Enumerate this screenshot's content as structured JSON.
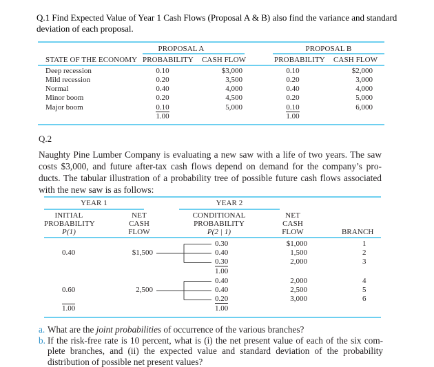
{
  "q1": {
    "title": "Q.1 Find Expected Value of Year 1 Cash Flows (Proposal A & B) also find the variance and standard deviation of each proposal.",
    "table": {
      "group_headers": [
        "PROPOSAL A",
        "PROPOSAL B"
      ],
      "col_headers": [
        "STATE OF THE ECONOMY",
        "PROBABILITY",
        "CASH FLOW",
        "PROBABILITY",
        "CASH FLOW"
      ],
      "rows": [
        {
          "state": "Deep recession",
          "prob_a": "0.10",
          "cf_a": "$3,000",
          "prob_b": "0.10",
          "cf_b": "$2,000"
        },
        {
          "state": "Mild recession",
          "prob_a": "0.20",
          "cf_a": "3,500",
          "prob_b": "0.20",
          "cf_b": "3,000"
        },
        {
          "state": "Normal",
          "prob_a": "0.40",
          "cf_a": "4,000",
          "prob_b": "0.40",
          "cf_b": "4,000"
        },
        {
          "state": "Minor boom",
          "prob_a": "0.20",
          "cf_a": "4,500",
          "prob_b": "0.20",
          "cf_b": "5,000"
        },
        {
          "state": "Major boom",
          "prob_a": "0.10",
          "cf_a": "5,000",
          "prob_b": "0.10",
          "cf_b": "6,000"
        }
      ],
      "totals": {
        "prob_a": "1.00",
        "prob_b": "1.00"
      }
    }
  },
  "q2": {
    "label": "Q.2",
    "paragraph": "Naughty Pine Lumber Company is evaluating a new saw with a life of two years. The saw costs $3,000, and future after-tax cash flows depend on demand for the company’s pro-ducts. The tabular illustration of a probability tree of possible future cash flows associated with the new saw is as follows:",
    "table": {
      "group_headers": [
        "YEAR 1",
        "YEAR 2"
      ],
      "col_headers": {
        "initial_prob": [
          "INITIAL",
          "PROBABILITY",
          "P(1)"
        ],
        "net_cf1": [
          "NET",
          "CASH",
          "FLOW"
        ],
        "cond_prob": [
          "CONDITIONAL",
          "PROBABILITY",
          "P(2 | 1)"
        ],
        "net_cf2": [
          "NET",
          "CASH",
          "FLOW"
        ],
        "branch": "BRANCH"
      },
      "groups": [
        {
          "initial_prob": "0.40",
          "cash_flow_y1": "$1,500",
          "conditional": [
            "0.30",
            "0.40",
            "0.30"
          ],
          "cond_total": "1.00",
          "cash_flow_y2": [
            "$1,000",
            "1,500",
            "2,000"
          ],
          "branches": [
            "1",
            "2",
            "3"
          ]
        },
        {
          "initial_prob": "0.60",
          "cash_flow_y1": "2,500",
          "conditional": [
            "0.40",
            "0.40",
            "0.20"
          ],
          "cond_total": "1.00",
          "cash_flow_y2": [
            "2,000",
            "2,500",
            "3,000"
          ],
          "branches": [
            "4",
            "5",
            "6"
          ]
        }
      ],
      "initial_total": "1.00"
    },
    "questions": [
      {
        "label": "a.",
        "pre": "What are the ",
        "em": "joint probabilities",
        "post": " of occurrence of the various branches?"
      },
      {
        "label": "b.",
        "text": "If the risk-free rate is 10 percent, what is (i) the net present value of each of the six com-plete branches, and (ii) the expected value and standard deviation of the probability distribution of possible net present values?"
      }
    ]
  }
}
